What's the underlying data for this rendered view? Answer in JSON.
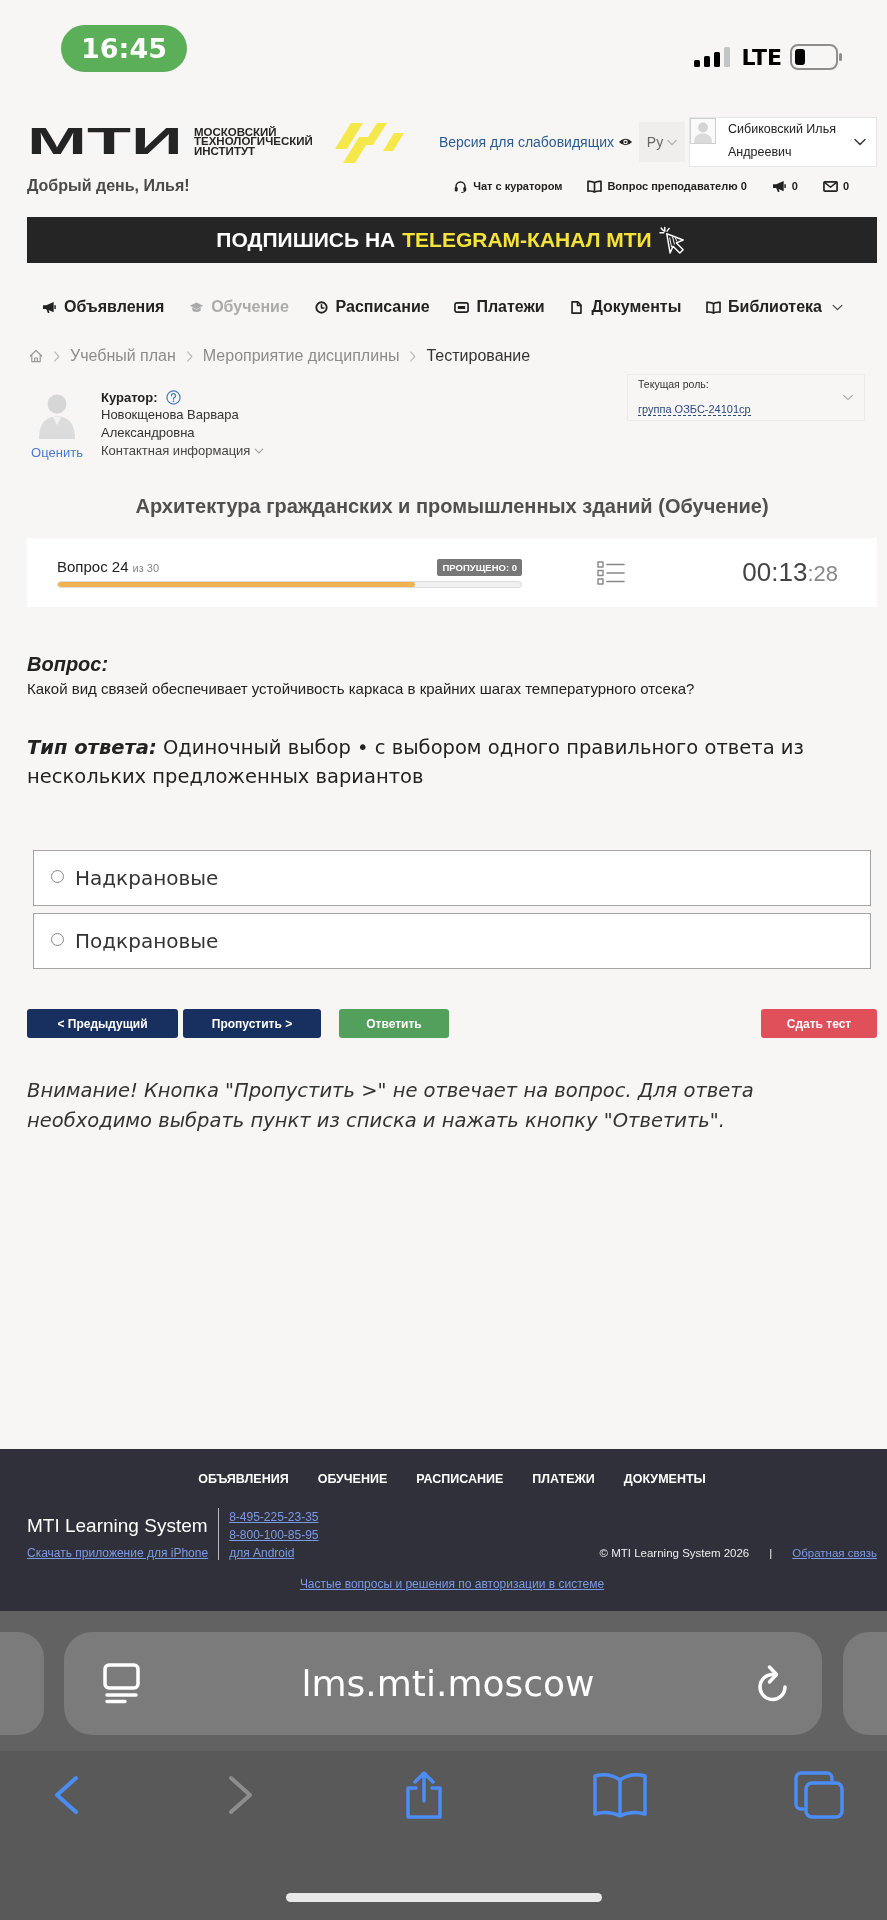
{
  "status_bar": {
    "time": "16:45",
    "network": "LTE"
  },
  "header": {
    "logo": {
      "wordmark": "МТИ",
      "subtitle": "МОСКОВСКИЙ ТЕХНОЛОГИЧЕСКИЙ ИНСТИТУТ"
    },
    "accessibility_link": "Версия для слабовидящих",
    "language": "Ру",
    "user": "Сибиковский Илья Андреевич",
    "greeting": "Добрый день, Илья!",
    "links": [
      {
        "kind": "chat",
        "label": "Чат с куратором"
      },
      {
        "kind": "teacher_question",
        "label": "Вопрос преподавателю 0"
      },
      {
        "kind": "announcements",
        "label": "0"
      },
      {
        "kind": "messages",
        "label": "0"
      }
    ]
  },
  "banner": {
    "text": "ПОДПИШИСЬ НА",
    "highlight": "TELEGRAM-КАНАЛ МТИ"
  },
  "nav": [
    {
      "kind": "announcements",
      "label": "Объявления",
      "selected": false,
      "dropdown": false
    },
    {
      "kind": "learning",
      "label": "Обучение",
      "selected": true,
      "dropdown": false
    },
    {
      "kind": "schedule",
      "label": "Расписание",
      "selected": false,
      "dropdown": false
    },
    {
      "kind": "payments",
      "label": "Платежи",
      "selected": false,
      "dropdown": false
    },
    {
      "kind": "documents",
      "label": "Документы",
      "selected": false,
      "dropdown": false
    },
    {
      "kind": "library",
      "label": "Библиотека",
      "selected": false,
      "dropdown": true
    }
  ],
  "breadcrumbs": [
    {
      "label": "Учебный план",
      "current": false
    },
    {
      "label": "Мероприятие дисциплины",
      "current": false
    },
    {
      "label": "Тестирование",
      "current": true
    }
  ],
  "curator": {
    "label": "Куратор:",
    "name": "Новокщенова Варвара Александровна",
    "rate_link": "Оценить",
    "contacts": "Контактная информация"
  },
  "role": {
    "label": "Текущая роль:",
    "value": "группа ОЗБС-24101ср"
  },
  "course_title": "Архитектура гражданских и промышленных зданий (Обучение)",
  "progress": {
    "question": "Вопрос 24",
    "total": "из 30",
    "skipped": "ПРОПУЩЕНО: 0",
    "level": 0.77,
    "timer": "00:13",
    "timer_seconds": ":28"
  },
  "question": {
    "heading": "Вопрос:",
    "text": "Какой вид связей обеспечивает устойчивость каркаса в крайних шагах температурного отсека?",
    "answer_type": "**Тип ответа:** Одиночный выбор • с выбором одного правильного ответа из нескольких предложенных вариантов",
    "options": [
      {
        "label": "Надкрановые",
        "selected": false
      },
      {
        "label": "Подкрановые",
        "selected": false
      }
    ]
  },
  "actions": [
    {
      "kind": "previous",
      "label": "< Предыдущий"
    },
    {
      "kind": "skip",
      "label": "Пропустить >"
    },
    {
      "kind": "answer",
      "label": "Ответить"
    },
    {
      "kind": "submit",
      "label": "Сдать тест"
    }
  ],
  "notice": "Внимание! Кнопка \"Пропустить >\" не отвечает на вопрос. Для ответа необходимо выбрать пункт из списка и нажать кнопку \"Ответить\".",
  "footer": {
    "nav": [
      "ОБЪЯВЛЕНИЯ",
      "ОБУЧЕНИЕ",
      "РАСПИСАНИЕ",
      "ПЛАТЕЖИ",
      "ДОКУМЕНТЫ"
    ],
    "brand": "MTI Learning System",
    "iphone_link": "Скачать приложение для iPhone",
    "phones": [
      "8-495-225-23-35",
      "8-800-100-85-95"
    ],
    "android_link": "для Android",
    "copyright": "© MTI Learning System 2026",
    "separator": "|",
    "feedback_link": "Обратная связь",
    "faq_link": "Частые вопросы и решения по авторизации в системе"
  },
  "browser": {
    "url": "lms.mti.moscow",
    "toolbar": [
      {
        "kind": "back",
        "disabled": false
      },
      {
        "kind": "forward",
        "disabled": true
      },
      {
        "kind": "share",
        "disabled": false
      },
      {
        "kind": "bookmarks",
        "disabled": false
      },
      {
        "kind": "tabs",
        "disabled": false
      }
    ]
  }
}
